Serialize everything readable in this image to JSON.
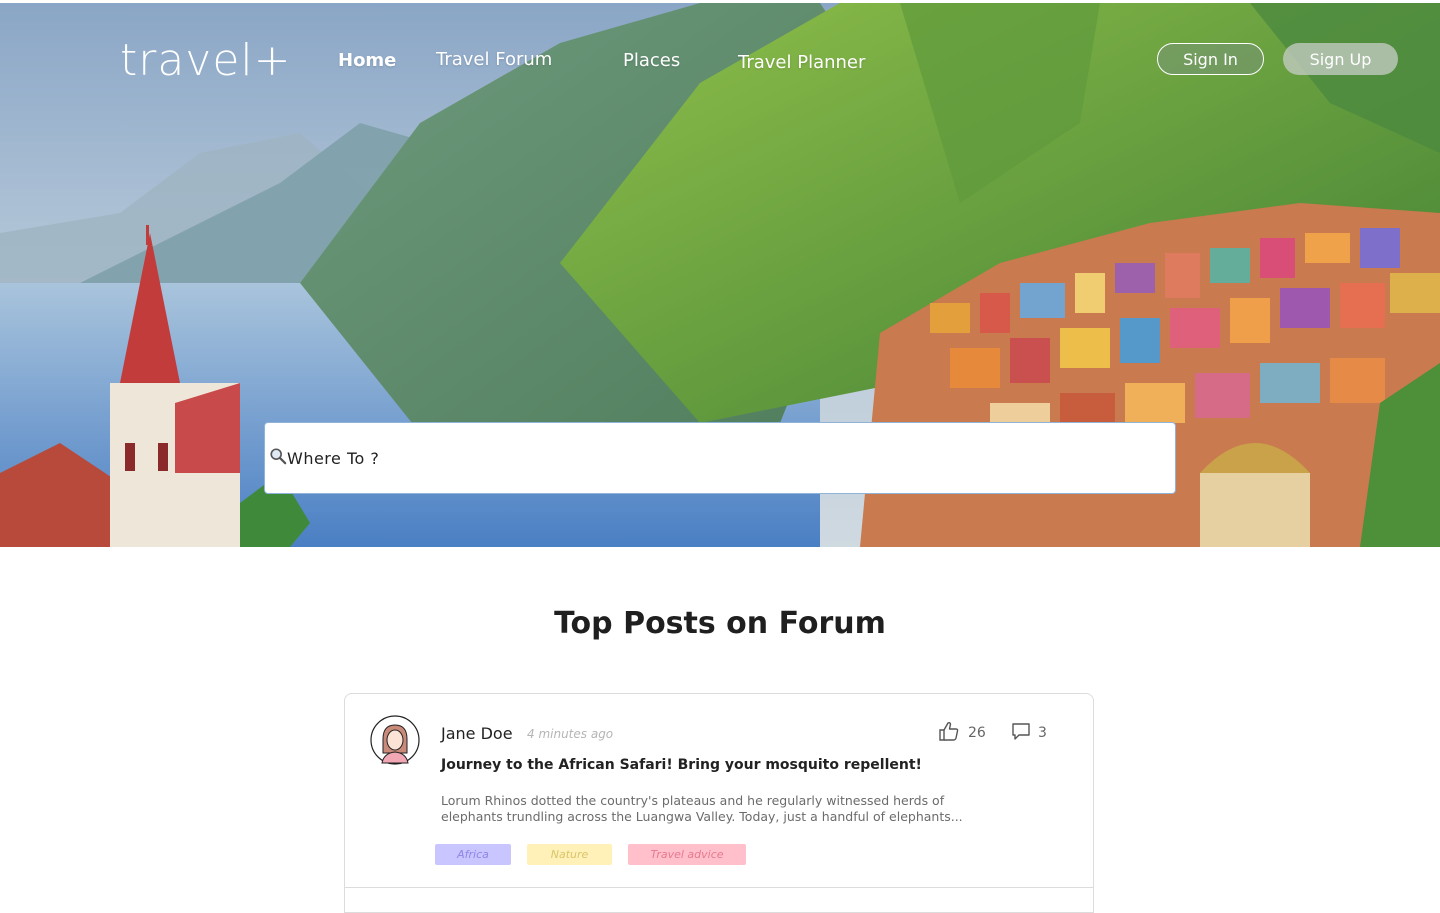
{
  "brand": {
    "logo_text": "travel+"
  },
  "nav": {
    "home": "Home",
    "forum": "Travel Forum",
    "places": "Places",
    "planner": "Travel Planner"
  },
  "auth": {
    "sign_in": "Sign In",
    "sign_up": "Sign Up"
  },
  "search": {
    "placeholder": "Where To ?",
    "icon": "magnifier-icon"
  },
  "forum_section": {
    "title": "Top Posts on Forum",
    "posts": [
      {
        "author": "Jane Doe",
        "time": "4 minutes ago",
        "likes": "26",
        "comments": "3",
        "title": "Journey to the African Safari! Bring your mosquito repellent!",
        "body": "Lorum Rhinos dotted the country's plateaus and he regularly witnessed herds of elephants trundling across the Luangwa Valley. Today, just a handful of elephants...",
        "tags": [
          {
            "label": "Africa",
            "bg": "#c9c6ff",
            "fg": "#8c86e6"
          },
          {
            "label": "Nature",
            "bg": "#fff1b8",
            "fg": "#d9c56a"
          },
          {
            "label": "Travel advice",
            "bg": "#ffc0cc",
            "fg": "#e5798f"
          }
        ]
      }
    ]
  },
  "colors": {
    "accent_text": "#1f1f1f",
    "search_border": "#8fb3d9"
  }
}
